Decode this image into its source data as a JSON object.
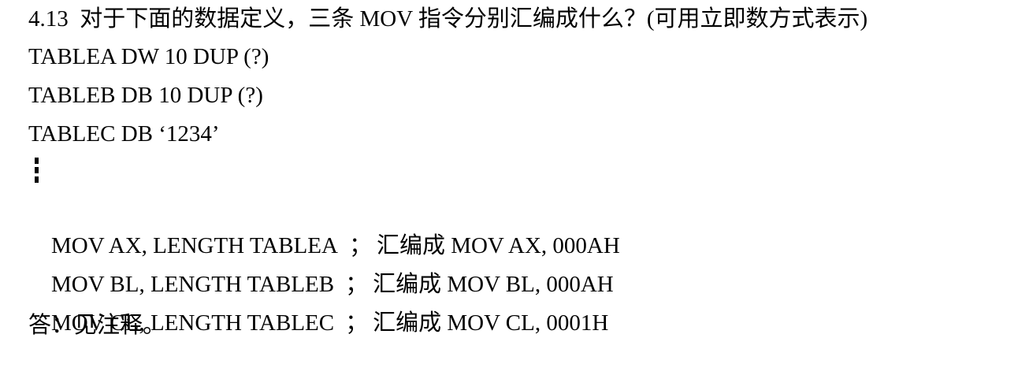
{
  "question": "4.13  对于下面的数据定义，三条 MOV 指令分别汇编成什么？(可用立即数方式表示)",
  "definitions": [
    "TABLEA DW 10 DUP (?)",
    "TABLEB DB 10 DUP (?)",
    "TABLEC DB ‘1234’"
  ],
  "instructions": [
    {
      "code": "MOV AX, LENGTH TABLEA",
      "separator": "；",
      "comment": "汇编成 MOV AX, 000AH"
    },
    {
      "code": "MOV BL, LENGTH TABLEB",
      "separator": "；",
      "comment": "汇编成 MOV BL, 000AH"
    },
    {
      "code": "MOV CL, LENGTH TABLEC",
      "separator": "；",
      "comment": "汇编成 MOV CL, 0001H"
    }
  ],
  "answer": "答：见注释。"
}
